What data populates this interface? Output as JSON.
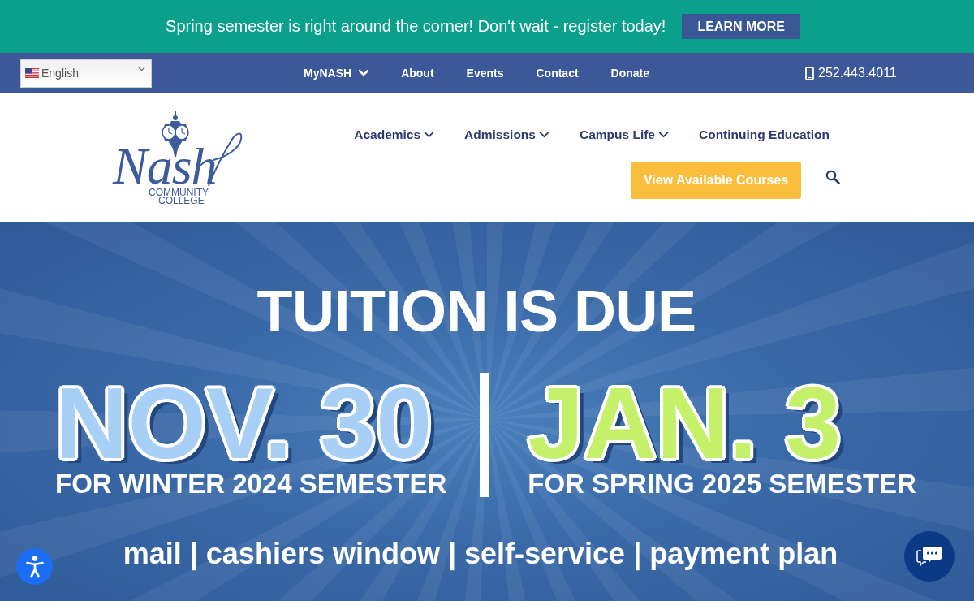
{
  "announcement": {
    "text": "Spring semester is right around the corner! Don't wait - register today!",
    "button": "LEARN MORE"
  },
  "utility_bar": {
    "language": "English",
    "links": [
      {
        "label": "MyNASH",
        "has_menu": true
      },
      {
        "label": "About",
        "has_menu": false
      },
      {
        "label": "Events",
        "has_menu": false
      },
      {
        "label": "Contact",
        "has_menu": false
      },
      {
        "label": "Donate",
        "has_menu": false
      }
    ],
    "phone": "252.443.4011"
  },
  "header": {
    "logo": {
      "script": "Nash",
      "line_1": "COMMUNITY",
      "line_2": "COLLEGE"
    },
    "nav": [
      {
        "label": "Academics",
        "has_menu": true
      },
      {
        "label": "Admissions",
        "has_menu": true
      },
      {
        "label": "Campus Life",
        "has_menu": true
      },
      {
        "label": "Continuing Education",
        "has_menu": false
      }
    ],
    "cta_button": "View Available Courses"
  },
  "hero": {
    "headline": "TUITION IS DUE",
    "deadlines": [
      {
        "date": "NOV. 30",
        "term": "FOR WINTER 2024 SEMESTER",
        "color": "#a8cff5"
      },
      {
        "date": "JAN. 3",
        "term": "FOR SPRING 2025 SEMESTER",
        "color": "#c4f06a"
      }
    ],
    "payment_methods": "mail | cashiers window | self-service | payment plan"
  }
}
